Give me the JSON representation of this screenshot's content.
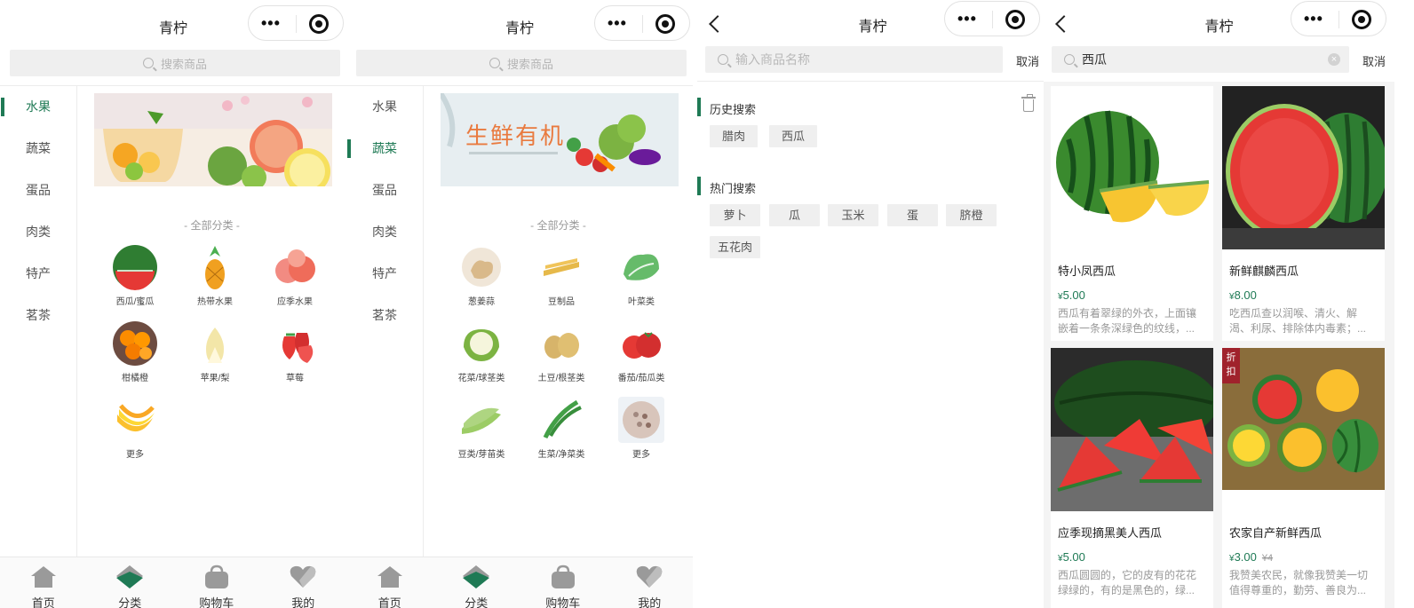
{
  "colors": {
    "accent": "#1f7a55",
    "tag": "#a0222c",
    "price": "#1f7a55"
  },
  "app_title": "青柠",
  "category_page": {
    "search_placeholder": "搜索商品",
    "sidebar": [
      "水果",
      "蔬菜",
      "蛋品",
      "肉类",
      "特产",
      "茗茶"
    ],
    "all_categories": "- 全部分类 -",
    "fruit_items": [
      "西瓜/蜜瓜",
      "热带水果",
      "应季水果",
      "柑橘橙",
      "苹果/梨",
      "草莓",
      "更多"
    ],
    "veg_banner_text": "生鲜有机",
    "veg_items": [
      "葱姜蒜",
      "豆制品",
      "叶菜类",
      "花菜/球茎类",
      "土豆/根茎类",
      "番茄/茄瓜类",
      "豆类/芽苗类",
      "生菜/净菜类",
      "更多"
    ]
  },
  "tabbar": [
    "首页",
    "分类",
    "购物车",
    "我的"
  ],
  "search_page": {
    "placeholder": "输入商品名称",
    "cancel": "取消",
    "history_title": "历史搜索",
    "history": [
      "腊肉",
      "西瓜"
    ],
    "hot_title": "热门搜索",
    "hot": [
      "萝卜",
      "瓜",
      "玉米",
      "蛋",
      "脐橙",
      "五花肉"
    ]
  },
  "results_page": {
    "query": "西瓜",
    "cancel": "取消",
    "products": [
      {
        "name": "特小凤西瓜",
        "currency": "¥",
        "price": "5.00",
        "old_price": "",
        "desc": "西瓜有着翠绿的外衣，上面镶嵌着一条条深绿色的纹线，...",
        "tag": ""
      },
      {
        "name": "新鲜麒麟西瓜",
        "currency": "¥",
        "price": "8.00",
        "old_price": "",
        "desc": "吃西瓜查以润喉、清火、解渴、利尿、排除体内毒素；...",
        "tag": ""
      },
      {
        "name": "应季现摘黑美人西瓜",
        "currency": "¥",
        "price": "5.00",
        "old_price": "",
        "desc": "西瓜圆圆的，它的皮有的花花绿绿的，有的是黑色的，绿...",
        "tag": ""
      },
      {
        "name": "农家自产新鲜西瓜",
        "currency": "¥",
        "price": "3.00",
        "old_price": "¥4",
        "desc": "我赞美农民，就像我赞美一切值得尊重的，勤劳、善良为...",
        "tag": "折扣"
      }
    ]
  }
}
